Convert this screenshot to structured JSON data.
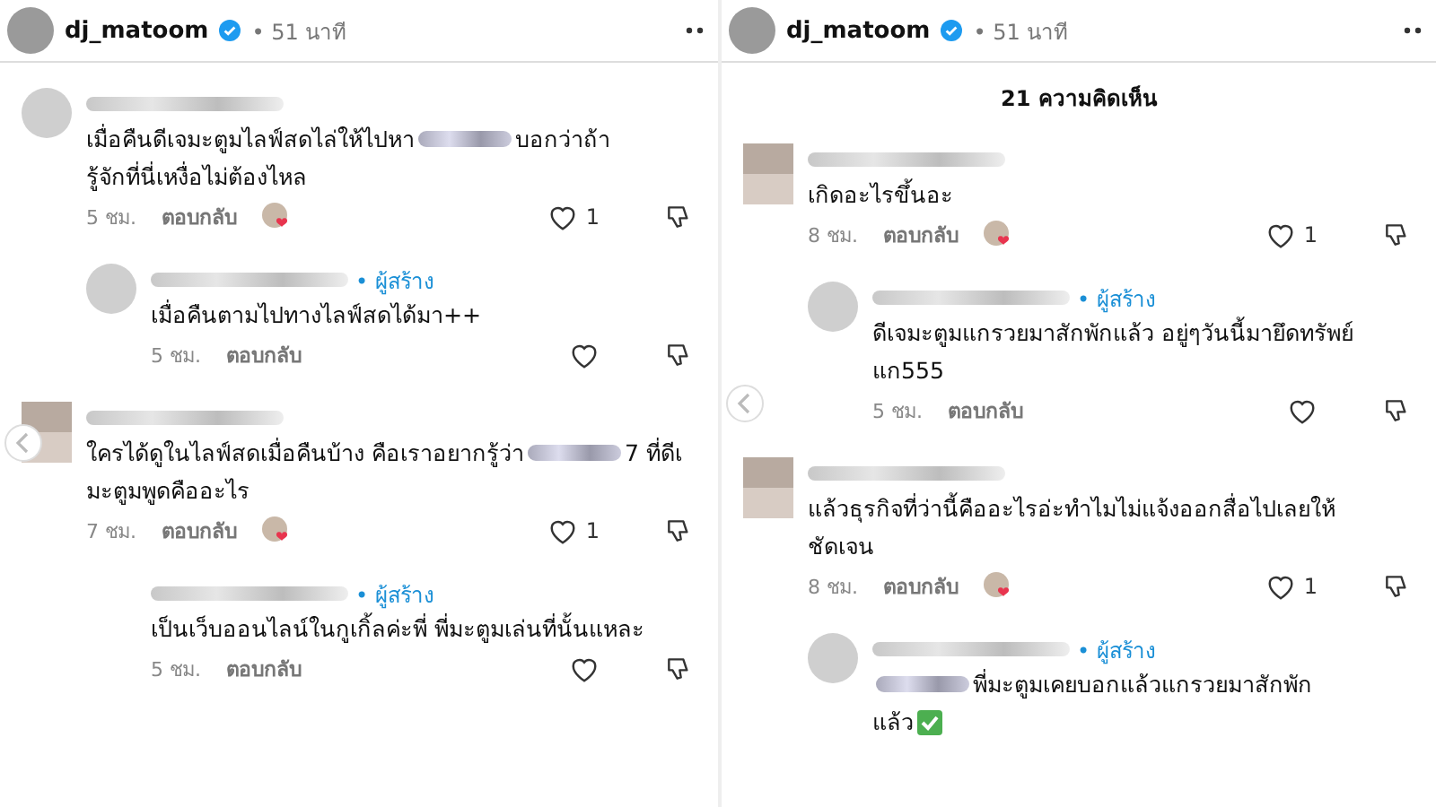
{
  "panels": [
    {
      "header": {
        "username": "dj_matoom",
        "verified": true,
        "time": "• 51 นาที"
      },
      "comments": [
        {
          "avatar": {
            "kind": "photo"
          },
          "lines": [
            [
              {
                "kind": "text",
                "text": "เมื่อคืนดีเจมะตูมไลฟ์สดไล่ให้ไปหา"
              },
              {
                "kind": "blur"
              },
              {
                "kind": "text",
                "text": "บอกว่าถ้า"
              }
            ],
            [
              {
                "kind": "text",
                "text": "รู้จักที่นี่เหงื่อไม่ต้องไหล"
              }
            ]
          ],
          "time": "5 ชม.",
          "reply_label": "ตอบกลับ",
          "liked_by_creator": true,
          "likes": "1",
          "replies": [
            {
              "avatar": {
                "kind": "photo"
              },
              "creator_label": "• ผู้สร้าง",
              "lines": [
                [
                  {
                    "kind": "text",
                    "text": "เมื่อคืนตามไปทางไลฟ์สดได้มา++"
                  }
                ]
              ],
              "time": "5 ชม.",
              "reply_label": "ตอบกลับ",
              "liked_by_creator": false
            }
          ]
        },
        {
          "avatar": {
            "kind": "pixelated"
          },
          "lines": [
            [
              {
                "kind": "text",
                "text": "ใครได้ดูในไลฟ์สดเมื่อคืนบ้าง คือเราอยากรู้ว่า"
              },
              {
                "kind": "blur"
              },
              {
                "kind": "text",
                "text": "7 ที่ดีเ"
              }
            ],
            [
              {
                "kind": "text",
                "text": "มะตูมพูดคืออะไร"
              }
            ]
          ],
          "time": "7 ชม.",
          "reply_label": "ตอบกลับ",
          "liked_by_creator": true,
          "likes": "1",
          "replies": [
            {
              "creator_label": "• ผู้สร้าง",
              "lines": [
                [
                  {
                    "kind": "text",
                    "text": "เป็นเว็บออนไลน์ในกูเกิ้ลค่ะพี่ พี่มะตูมเล่นที่นั้นแหละ"
                  }
                ]
              ],
              "time": "5 ชม.",
              "reply_label": "ตอบกลับ",
              "liked_by_creator": false
            }
          ]
        }
      ]
    },
    {
      "header": {
        "username": "dj_matoom",
        "verified": true,
        "time": "• 51 นาที"
      },
      "comments_title": "21 ความคิดเห็น",
      "comments": [
        {
          "avatar": {
            "kind": "pixelated"
          },
          "lines": [
            [
              {
                "kind": "text",
                "text": "เกิดอะไรขึ้นอะ"
              }
            ]
          ],
          "time": "8 ชม.",
          "reply_label": "ตอบกลับ",
          "liked_by_creator": true,
          "likes": "1",
          "replies": [
            {
              "avatar": {
                "kind": "photo"
              },
              "creator_label": "• ผู้สร้าง",
              "lines": [
                [
                  {
                    "kind": "text",
                    "text": "ดีเจมะตูมแกรวยมาสักพักแล้ว อยู่ๆวันนี้มายึดทรัพย์"
                  }
                ],
                [
                  {
                    "kind": "text",
                    "text": "แก555"
                  }
                ]
              ],
              "time": "5 ชม.",
              "reply_label": "ตอบกลับ",
              "liked_by_creator": false
            }
          ]
        },
        {
          "avatar": {
            "kind": "pixelated"
          },
          "lines": [
            [
              {
                "kind": "text",
                "text": "แล้วธุรกิจที่ว่านี้คืออะไรอ่ะทำไมไม่แจ้งออกสื่อไปเลยให้"
              }
            ],
            [
              {
                "kind": "text",
                "text": "ชัดเจน"
              }
            ]
          ],
          "time": "8 ชม.",
          "reply_label": "ตอบกลับ",
          "liked_by_creator": true,
          "likes": "1",
          "replies": [
            {
              "avatar": {
                "kind": "photo"
              },
              "creator_label": "• ผู้สร้าง",
              "lines": [
                [
                  {
                    "kind": "blur"
                  },
                  {
                    "kind": "text",
                    "text": "พี่มะตูมเคยบอกแล้วแกรวยมาสักพัก"
                  }
                ],
                [
                  {
                    "kind": "text",
                    "text": "แล้ว"
                  },
                  {
                    "kind": "check"
                  }
                ]
              ]
            }
          ]
        }
      ]
    }
  ]
}
